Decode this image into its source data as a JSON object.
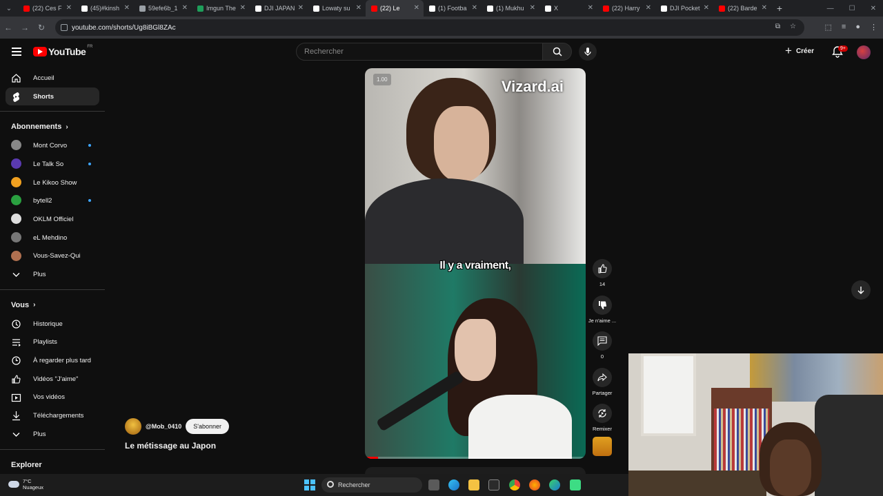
{
  "browser": {
    "tabs": [
      {
        "label": "(22) Ces F",
        "color": "#ff0000"
      },
      {
        "label": "(45)#kinsh",
        "color": "#ffffff"
      },
      {
        "label": "59efe6b_1",
        "color": "#9aa0a6"
      },
      {
        "label": "Imgun The",
        "color": "#1e9e5a"
      },
      {
        "label": "DJI JAPAN",
        "color": "#ffffff"
      },
      {
        "label": "Lowaty su",
        "color": "#ffffff"
      },
      {
        "label": "(22) Le",
        "color": "#ff0000",
        "active": true
      },
      {
        "label": "(1) Footba",
        "color": "#ffffff"
      },
      {
        "label": "(1) Mukhu",
        "color": "#ffffff"
      },
      {
        "label": "X",
        "color": "#ffffff"
      },
      {
        "label": "(22) Harry",
        "color": "#ff0000"
      },
      {
        "label": "DJI Pocket",
        "color": "#ffffff"
      },
      {
        "label": "(22) Barde",
        "color": "#ff0000"
      }
    ],
    "url": "youtube.com/shorts/Ug8iBGl8ZAc"
  },
  "header": {
    "logo_text": "YouTube",
    "logo_region": "FR",
    "search_placeholder": "Rechercher",
    "create_label": "Créer",
    "notif_badge": "9+"
  },
  "sidebar": {
    "main": [
      {
        "label": "Accueil",
        "icon": "home-icon"
      },
      {
        "label": "Shorts",
        "icon": "shorts-icon",
        "active": true
      }
    ],
    "subs_title": "Abonnements",
    "subs": [
      {
        "label": "Mont Corvo",
        "color": "#888888",
        "dot": true
      },
      {
        "label": "Le Talk So",
        "color": "#5a3ab0",
        "dot": true
      },
      {
        "label": "Le Kikoo Show",
        "color": "#f0a020",
        "dot": false
      },
      {
        "label": "bytell2",
        "color": "#2aa040",
        "dot": true
      },
      {
        "label": "OKLM Officiel",
        "color": "#dddddd",
        "dot": false
      },
      {
        "label": "eL Mehdino",
        "color": "#777777",
        "dot": false
      },
      {
        "label": "Vous-Savez-Qui",
        "color": "#b07050",
        "dot": false
      },
      {
        "label": "Plus",
        "chevron": true
      }
    ],
    "you_title": "Vous",
    "you": [
      {
        "label": "Historique",
        "icon": "history-icon"
      },
      {
        "label": "Playlists",
        "icon": "playlists-icon"
      },
      {
        "label": "À regarder plus tard",
        "icon": "watch-later-icon"
      },
      {
        "label": "Vidéos \"J'aime\"",
        "icon": "liked-videos-icon"
      },
      {
        "label": "Vos vidéos",
        "icon": "your-videos-icon"
      },
      {
        "label": "Téléchargements",
        "icon": "downloads-icon"
      },
      {
        "label": "Plus",
        "icon": "chevron-down-icon"
      }
    ],
    "explore_title": "Explorer"
  },
  "video": {
    "speed": "1.00",
    "watermark": "Vizard.ai",
    "caption": "Il y a vraiment,",
    "progress": 0.06,
    "channel": "@Mob_0410",
    "subscribe_label": "S'abonner",
    "title": "Le métissage au Japon"
  },
  "actions": {
    "like_count": "14",
    "dislike_label": "Je n'aime ...",
    "comment_count": "0",
    "share_label": "Partager",
    "remix_label": "Remixer"
  },
  "taskbar": {
    "temp": "7°C",
    "weather": "Nuageux",
    "search_label": "Rechercher"
  }
}
